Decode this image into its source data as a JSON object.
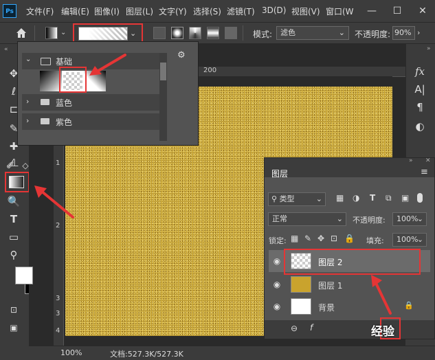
{
  "app": {
    "logo": "Ps"
  },
  "menubar": {
    "items": [
      "文件(F)",
      "编辑(E)",
      "图像(I)",
      "图层(L)",
      "文字(Y)",
      "选择(S)",
      "滤镜(T)",
      "3D(D)",
      "视图(V)",
      "窗口(W"
    ],
    "window_buttons": [
      "—",
      "☐",
      "✕"
    ]
  },
  "options_bar": {
    "mode_label": "模式:",
    "mode_value": "滤色",
    "opacity_label": "不透明度:",
    "opacity_value": "90%"
  },
  "ruler": {
    "top_label": "200",
    "left_labels": [
      "1",
      "2",
      "3",
      "3",
      "4"
    ]
  },
  "gradient_picker": {
    "folders": [
      {
        "name": "基础",
        "expanded": true
      },
      {
        "name": "蓝色",
        "expanded": false
      },
      {
        "name": "紫色",
        "expanded": false
      }
    ]
  },
  "status_bar": {
    "zoom": "100%",
    "doc_info": "文档:527.3K/527.3K"
  },
  "layers_panel": {
    "title": "图层",
    "filter_kind": "类型",
    "blend_mode": "正常",
    "opacity_label": "不透明度:",
    "opacity_value": "100%",
    "lock_label": "锁定:",
    "fill_label": "填充:",
    "fill_value": "100%",
    "layers": [
      {
        "name": "图层 2",
        "selected": true
      },
      {
        "name": "图层 1",
        "selected": false
      },
      {
        "name": "背景",
        "selected": false,
        "locked": true
      }
    ],
    "footer_glyphs": [
      "⊖",
      "f"
    ]
  },
  "watermark": {
    "text": "经验"
  },
  "colors": {
    "accent_red": "#e53535",
    "gold": "#c9a32d",
    "ps_blue": "#31a8ff"
  }
}
